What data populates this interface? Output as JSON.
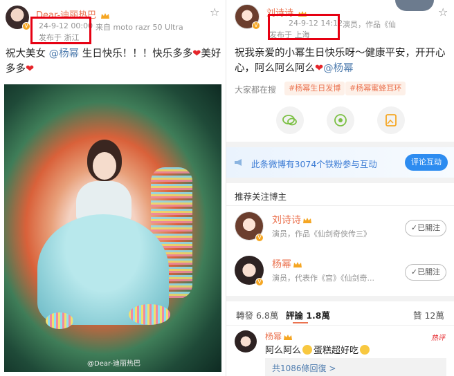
{
  "left_post": {
    "author": "Dear-迪丽热巴",
    "time": "24-9-12 00:00",
    "device": "来自 moto razr 50 Ultra",
    "location": "发布于 浙江",
    "text_prefix": "祝大美女",
    "mention": "@杨幂",
    "text_suffix": " 生日快乐！！！快乐多多",
    "text_suffix2": "美好多多",
    "heart": "❤",
    "watermark": "@Dear-迪丽热巴"
  },
  "right_post": {
    "author": "刘诗诗",
    "time": "24-9-12 14:12",
    "location": "发布于 上海",
    "meta_tail": "演员，作品《仙",
    "text_line1": "祝我亲爱的小幂生日快乐呀～健康平安，开开心",
    "text_line2_prefix": "心，阿么阿么阿么",
    "mention": "@杨幂",
    "heart": "❤",
    "search_label": "大家都在搜",
    "tags": [
      "#杨幂生日发博",
      "#杨幂蜜蜂耳环"
    ],
    "interact_banner": "此条微博有3074个铁粉参与互动",
    "interact_button": "评论互动",
    "recommend_title": "推荐关注博主",
    "recommend": [
      {
        "name": "刘诗诗",
        "desc": "演员，作品《仙剑奇侠传三》",
        "button": "✓已關注"
      },
      {
        "name": "杨幂",
        "desc": "演员，代表作《宫》《仙剑奇...",
        "button": "✓已關注"
      }
    ],
    "stats": {
      "repost": "轉發 6.8萬",
      "comment": "評論 1.8萬",
      "like": "贊 12萬"
    },
    "comment": {
      "author": "杨幂",
      "text_prefix": "阿么阿么",
      "text_suffix": "蛋糕超好吃",
      "hot_badge": "热评",
      "replies": "共1086條回復 >"
    }
  },
  "colors": {
    "accent": "#eb7350",
    "link": "#507daf",
    "red": "#e60012",
    "blue_btn": "#2d8cf0"
  }
}
